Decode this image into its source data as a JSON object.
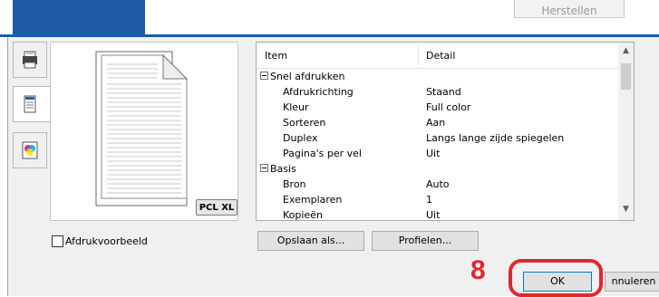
{
  "header": {
    "reset_label": "Herstellen"
  },
  "preview": {
    "badge": "PCL XL"
  },
  "table": {
    "columns": [
      "Item",
      "Detail"
    ],
    "rows": [
      {
        "item": "Snel afdrukken",
        "detail": "",
        "group": true
      },
      {
        "item": "Afdrukrichting",
        "detail": "Staand",
        "group": false
      },
      {
        "item": "Kleur",
        "detail": "Full color",
        "group": false
      },
      {
        "item": "Sorteren",
        "detail": "Aan",
        "group": false
      },
      {
        "item": "Duplex",
        "detail": "Langs lange zijde spiegelen",
        "group": false
      },
      {
        "item": "Pagina's per vel",
        "detail": "Uit",
        "group": false
      },
      {
        "item": "Basis",
        "detail": "",
        "group": true
      },
      {
        "item": "Bron",
        "detail": "Auto",
        "group": false
      },
      {
        "item": "Exemplaren",
        "detail": "1",
        "group": false
      },
      {
        "item": "Kopieën",
        "detail": "Uit",
        "group": false
      }
    ]
  },
  "options": {
    "preview_checkbox_label": "Afdrukvoorbeeld"
  },
  "buttons": {
    "save_as": "Opslaan als...",
    "profiles": "Profielen...",
    "ok": "OK",
    "cancel": "nnuleren"
  },
  "annotation": {
    "step_number": "8",
    "color": "#e0282e"
  }
}
